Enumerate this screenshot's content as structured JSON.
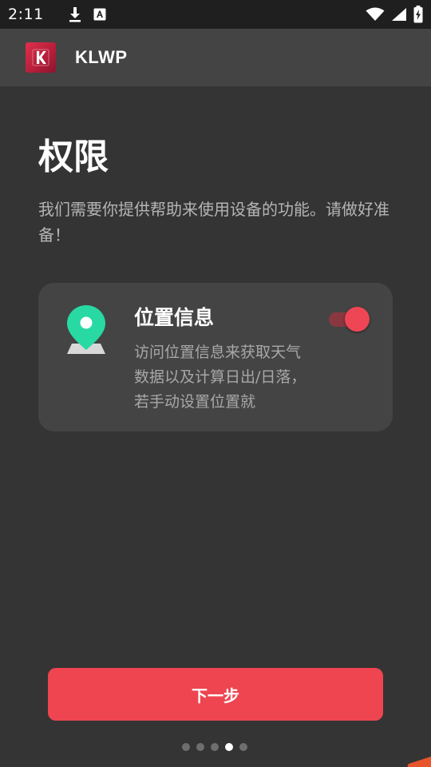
{
  "status_bar": {
    "time": "2:11",
    "icons": [
      "download-icon",
      "accessibility-notification-icon",
      "wifi-icon",
      "cell-signal-icon",
      "battery-charging-icon"
    ]
  },
  "app_bar": {
    "logo": "klwp-logo",
    "logo_letter": "K",
    "title": "KLWP"
  },
  "page": {
    "title": "权限",
    "description": "我们需要你提供帮助来使用设备的功能。请做好准备！"
  },
  "permissions": [
    {
      "icon": "location-pin-icon",
      "title": "位置信息",
      "description": "访问位置信息来获取天气数据以及计算日出/日落，若手动设置位置就",
      "enabled": true
    }
  ],
  "next_button": {
    "label": "下一步"
  },
  "pagination": {
    "total": 5,
    "current": 4
  },
  "colors": {
    "background": "#343434",
    "app_bar": "#444444",
    "status_bar": "#1f1f1f",
    "accent": "#ee4551",
    "location_pin": "#28d9a4"
  }
}
